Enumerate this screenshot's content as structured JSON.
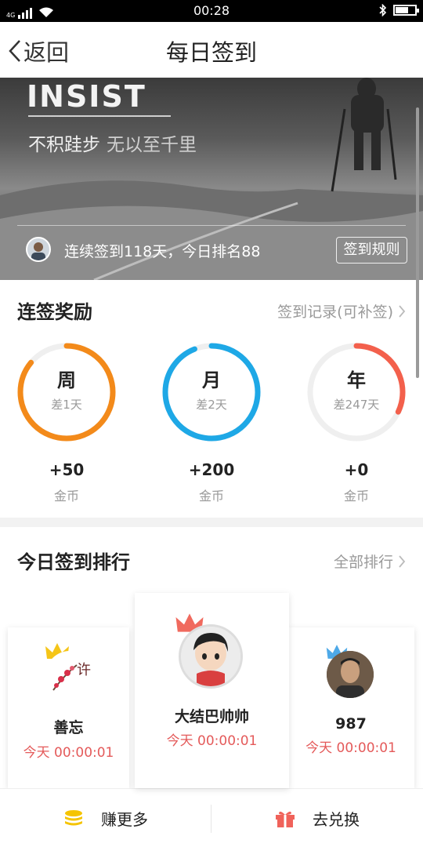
{
  "status_bar": {
    "time": "00:28",
    "network": "4G"
  },
  "nav": {
    "back_label": "返回",
    "title": "每日签到"
  },
  "hero": {
    "headline": "INSIST",
    "slogan_main": "不积跬步",
    "slogan_sub": "无以至千里",
    "streak_text": "连续签到118天，今日排名88",
    "rules_label": "签到规则"
  },
  "rewards_section": {
    "title": "连签奖励",
    "link_label": "签到记录(可补签)",
    "items": [
      {
        "period": "周",
        "remaining": "差1天",
        "amount": "+50",
        "unit": "金币",
        "color": "#F38A1A",
        "progress": 0.86
      },
      {
        "period": "月",
        "remaining": "差2天",
        "amount": "+200",
        "unit": "金币",
        "color": "#1EA8E6",
        "progress": 0.94
      },
      {
        "period": "年",
        "remaining": "差247天",
        "amount": "+0",
        "unit": "金币",
        "color": "#F3604C",
        "progress": 0.32
      }
    ]
  },
  "ranking_section": {
    "title": "今日签到排行",
    "link_label": "全部排行",
    "entries": [
      {
        "name": "善忘",
        "time": "今天 00:00:01",
        "crown_color": "#F5C518"
      },
      {
        "name": "大结巴帅帅",
        "time": "今天 00:00:01",
        "crown_color": "#F06A5E"
      },
      {
        "name": "987",
        "time": "今天 00:00:01",
        "crown_color": "#4EA9E8"
      }
    ]
  },
  "bottom_bar": {
    "earn_label": "赚更多",
    "exchange_label": "去兑换"
  }
}
